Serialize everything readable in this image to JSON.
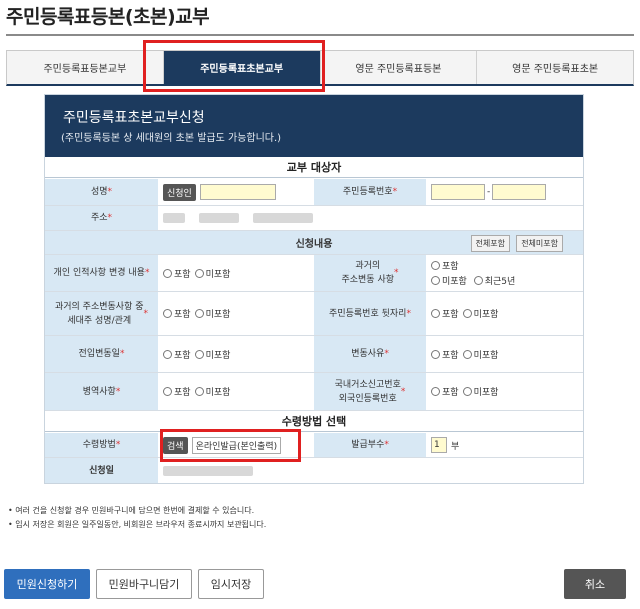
{
  "page": {
    "title": "주민등록표등본(초본)교부"
  },
  "tabs": [
    {
      "label": "주민등록표등본교부"
    },
    {
      "label": "주민등록표초본교부"
    },
    {
      "label": "영문 주민등록표등본"
    },
    {
      "label": "영문 주민등록표초본"
    }
  ],
  "active_tab_index": 1,
  "panel": {
    "title": "주민등록표초본교부신청",
    "subtitle": "(주민등록등본 상 세대원의 초본 발급도 가능합니다.)"
  },
  "sections": {
    "target": "교부 대상자",
    "content": "신청내용",
    "receive": "수령방법 선택"
  },
  "buttons": {
    "applicant": "신청인",
    "include_all": "전체포함",
    "exclude_all": "전체미포함",
    "search": "검색",
    "apply": "민원신청하기",
    "basket": "민원바구니담기",
    "temp_save": "임시저장",
    "cancel": "취소"
  },
  "fields": {
    "name": "성명",
    "rrn": "주민등록번호",
    "rrn_sep": "-",
    "address": "주소",
    "personal_change": "개인 인적사항 변경 내용",
    "past_address": "과거의\n주소변동 사항",
    "past_householder": "과거의 주소변동사항 중\n세대주 성명/관계",
    "rrn_back": "주민등록번호 뒷자리",
    "move_in_date": "전입변동일",
    "change_reason": "변동사유",
    "military": "병역사항",
    "overseas": "국내거소신고번호\n외국인등록번호",
    "method": "수령방법",
    "method_value": "온라인발급(본인출력)",
    "copies": "발급부수",
    "copies_value": "1",
    "copies_unit": "부",
    "apply_date": "신청일",
    "required_mark": "*"
  },
  "options": {
    "include": "포함",
    "exclude": "미포함",
    "recent5": "최근5년"
  },
  "notes": [
    "• 여러 건을 신청할 경우 민원바구니에 담으면 한번에 결제할 수 있습니다.",
    "• 임시 저장은 회원은 일주일동안, 비회원은 브라우저 종료시까지 보관됩니다."
  ],
  "colors": {
    "navy": "#1c3a5e",
    "label_bg": "#d8e8f4",
    "highlight": "#e02020",
    "primary_button": "#2f6fbd",
    "input_yellow": "#fffbd0"
  }
}
